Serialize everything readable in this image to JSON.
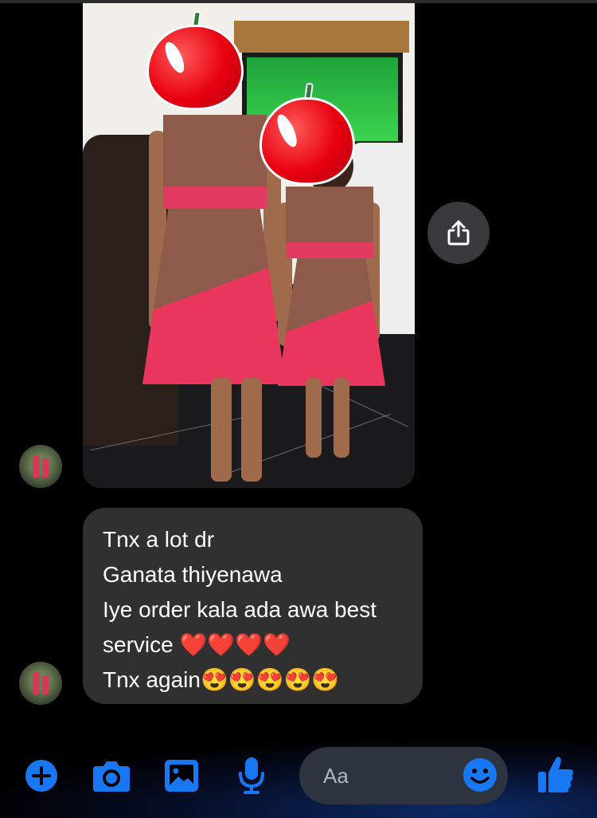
{
  "message": {
    "lines": [
      "Tnx a lot dr",
      "Ganata thiyenawa",
      "Iye order kala ada awa best",
      "service ❤️❤️❤️❤️",
      "Tnx again😍😍😍😍😍"
    ]
  },
  "composer": {
    "placeholder": "Aa"
  },
  "icons": {
    "share": "share-icon",
    "add": "plus-icon",
    "camera": "camera-icon",
    "gallery": "image-icon",
    "mic": "microphone-icon",
    "emoji": "smiley-icon",
    "like": "thumbs-up-icon"
  },
  "colors": {
    "accent": "#1877f2",
    "bubble": "#303030",
    "background": "#000000"
  }
}
